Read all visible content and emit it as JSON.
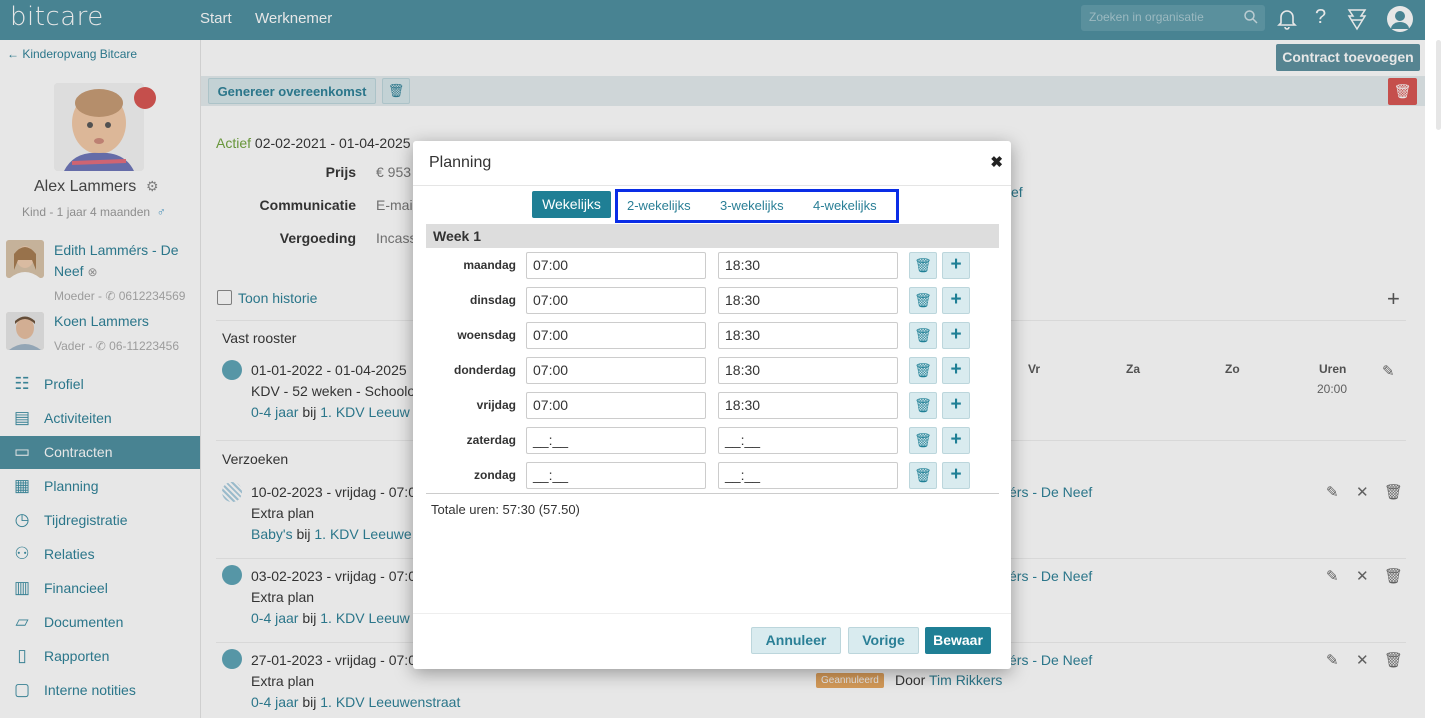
{
  "topbar": {
    "logo": "bitcare",
    "nav": [
      "Start",
      "Werknemer"
    ],
    "search_placeholder": "Zoeken in organisatie",
    "icons": [
      "search-icon",
      "bell-icon",
      "help-icon",
      "badge-icon",
      "user-icon"
    ]
  },
  "sidebar": {
    "back_label": "← Kinderopvang Bitcare",
    "child_name": "Alex Lammers",
    "child_sub": "Kind - 1 jaar 4 maanden",
    "gender_symbol": "♂",
    "relations": [
      {
        "name_line1": "Edith Lammérs - De",
        "name_line2": "Neef",
        "sub": "Moeder - ✆ 0612234569"
      },
      {
        "name_line1": "Koen Lammers",
        "sub": "Vader - ✆ 06-11223456"
      }
    ],
    "menu": [
      {
        "label": "Profiel",
        "icon": "☷"
      },
      {
        "label": "Activiteiten",
        "icon": "▤"
      },
      {
        "label": "Contracten",
        "icon": "▭"
      },
      {
        "label": "Planning",
        "icon": "▦"
      },
      {
        "label": "Tijdregistratie",
        "icon": "◷"
      },
      {
        "label": "Relaties",
        "icon": "⚇"
      },
      {
        "label": "Financieel",
        "icon": "▥"
      },
      {
        "label": "Documenten",
        "icon": "▱"
      },
      {
        "label": "Rapporten",
        "icon": "▯"
      },
      {
        "label": "Interne notities",
        "icon": "▢"
      }
    ],
    "active_index": 2
  },
  "main": {
    "contract_button": "Contract toevoegen",
    "generate_button": "Genereer overeenkomst",
    "status": "Actief",
    "period": "02-02-2021 - 01-04-2025",
    "fields": [
      {
        "label": "Prijs",
        "value": "€ 953"
      },
      {
        "label": "Communicatie",
        "value": "E-mai"
      },
      {
        "label": "Vergoeding",
        "value": "Incass"
      }
    ],
    "right_partial": "ef",
    "history_label": "Toon historie",
    "fixed_schedule_heading": "Vast rooster",
    "schedule_cols": [
      "Vr",
      "Za",
      "Zo",
      "Uren"
    ],
    "schedule_hours": "20:00",
    "schedule_row": {
      "date": "01-01-2022 - 01-04-2025",
      "line2": "KDV - 52 weken - Schoolo",
      "age": "0-4 jaar",
      "at": "bij",
      "location": "1. KDV Leeuw"
    },
    "requests_heading": "Verzoeken",
    "requests": [
      {
        "date": "10-02-2023 - vrijdag - 07:0",
        "type": "Extra plan",
        "group": "Baby's",
        "at": "bij",
        "location": "1. KDV Leeuwe",
        "person": "érs - De Neef"
      },
      {
        "date": "03-02-2023 - vrijdag - 07:0",
        "type": "Extra plan",
        "group": "0-4 jaar",
        "at": "bij",
        "location": "1. KDV Leeuw",
        "person": "érs - De Neef"
      },
      {
        "date": "27-01-2023 - vrijdag - 07:0",
        "type": "Extra plan",
        "group": "0-4 jaar",
        "at": "bij",
        "location": "1. KDV Leeuwenstraat",
        "person": "érs - De Neef",
        "badge": "Geannuleerd",
        "by": "Door",
        "by_person": "Tim Rikkers"
      }
    ]
  },
  "modal": {
    "title": "Planning",
    "close": "✖",
    "tabs": [
      "Wekelijks",
      "2-wekelijks",
      "3-wekelijks",
      "4-wekelijks"
    ],
    "week_label": "Week 1",
    "days": [
      {
        "day": "maandag",
        "start": "07:00",
        "end": "18:30"
      },
      {
        "day": "dinsdag",
        "start": "07:00",
        "end": "18:30"
      },
      {
        "day": "woensdag",
        "start": "07:00",
        "end": "18:30"
      },
      {
        "day": "donderdag",
        "start": "07:00",
        "end": "18:30"
      },
      {
        "day": "vrijdag",
        "start": "07:00",
        "end": "18:30"
      },
      {
        "day": "zaterdag",
        "start": "__:__",
        "end": "__:__"
      },
      {
        "day": "zondag",
        "start": "__:__",
        "end": "__:__"
      }
    ],
    "total": "Totale uren: 57:30 (57.50)",
    "buttons": {
      "cancel": "Annuleer",
      "previous": "Vorige",
      "save": "Bewaar"
    }
  },
  "colors": {
    "primary": "#4a8e9f",
    "accent": "#1f7f95",
    "danger": "#d9534f",
    "highlight_box": "#0a2de6"
  }
}
